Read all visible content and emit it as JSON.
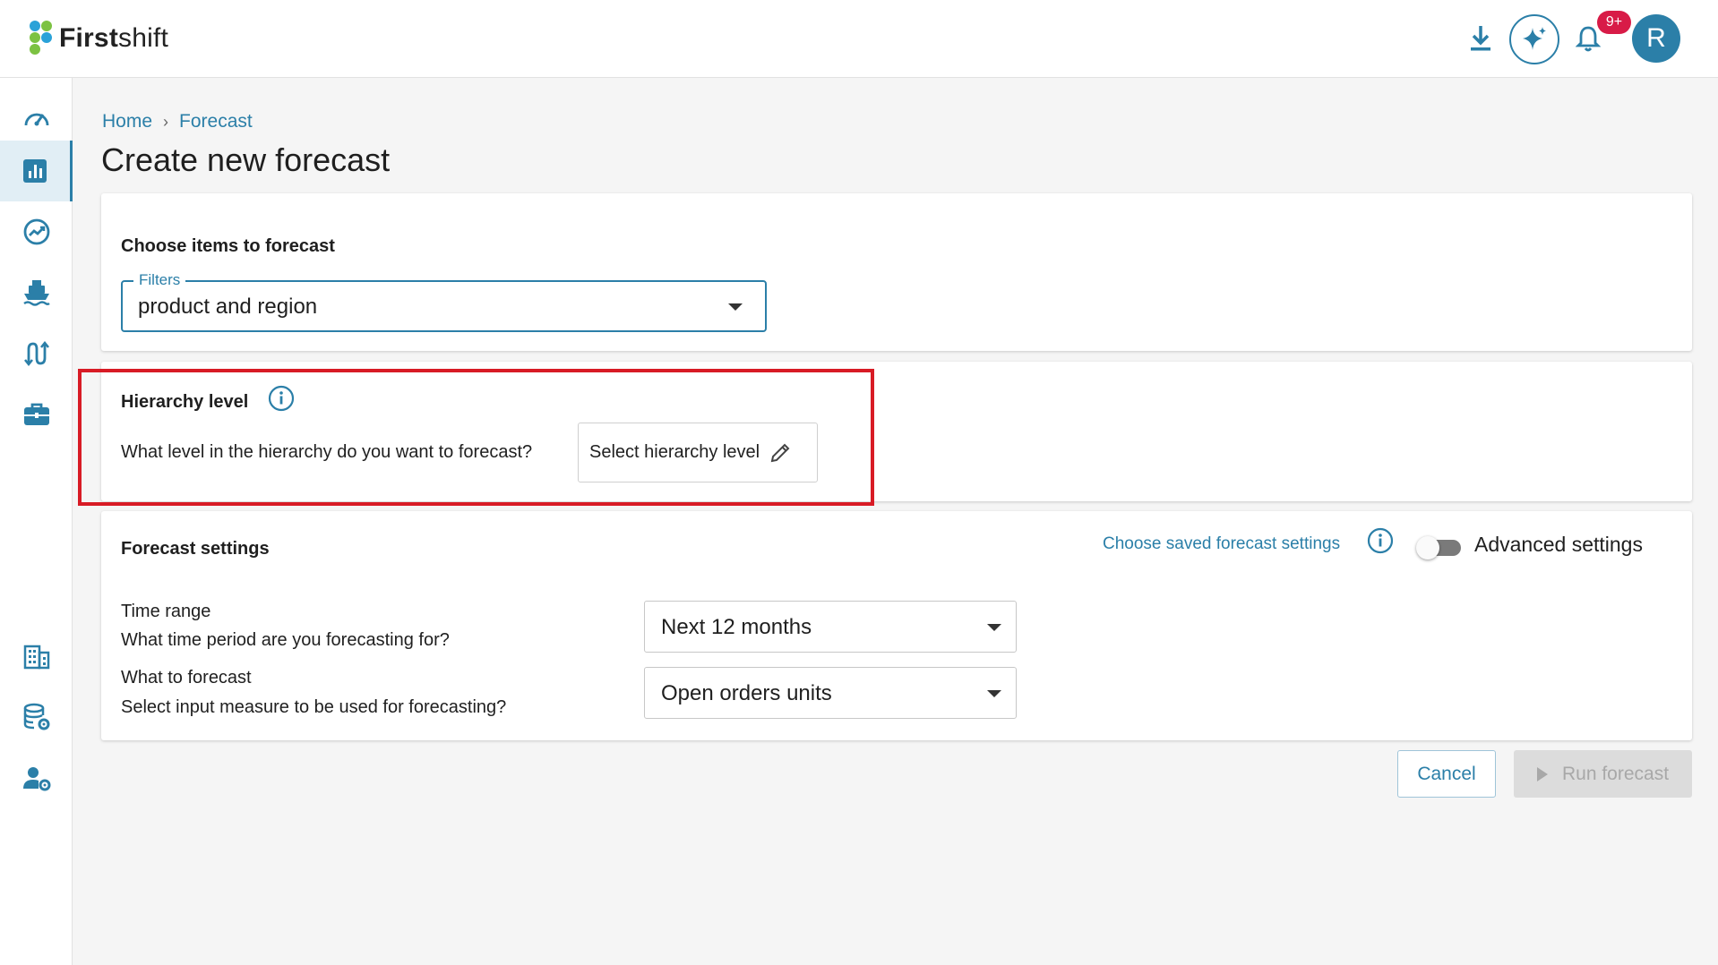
{
  "app": {
    "logo_bold": "First",
    "logo_light": "shift"
  },
  "header": {
    "notification_badge": "9+",
    "avatar_initial": "R"
  },
  "breadcrumb": {
    "home": "Home",
    "separator": "›",
    "current": "Forecast"
  },
  "page": {
    "title": "Create new forecast"
  },
  "items_card": {
    "title": "Choose items to forecast",
    "filters_label": "Filters",
    "filters_value": "product and region"
  },
  "hierarchy_card": {
    "title": "Hierarchy level",
    "question": "What level in the hierarchy do you want to forecast?",
    "button_label": "Select hierarchy level"
  },
  "settings_card": {
    "title": "Forecast settings",
    "saved_link": "Choose saved forecast settings",
    "advanced_label": "Advanced settings",
    "advanced_enabled": false,
    "time_range_label": "Time range",
    "time_range_question": "What time period are you forecasting for?",
    "time_range_value": "Next 12 months",
    "measure_label": "What to forecast",
    "measure_question": "Select input measure to be used for forecasting?",
    "measure_value": "Open orders units"
  },
  "actions": {
    "cancel": "Cancel",
    "run": "Run forecast"
  },
  "colors": {
    "accent": "#2b7fa8",
    "badge": "#d81b47",
    "highlight": "#d81b25"
  },
  "sidebar": {
    "items": [
      {
        "icon": "speedometer-icon",
        "active": false
      },
      {
        "icon": "bar-chart-icon",
        "active": true
      },
      {
        "icon": "trend-icon",
        "active": false
      },
      {
        "icon": "ship-icon",
        "active": false
      },
      {
        "icon": "transfer-icon",
        "active": false
      },
      {
        "icon": "briefcase-icon",
        "active": false
      },
      {
        "icon": "building-icon",
        "active": false
      },
      {
        "icon": "database-settings-icon",
        "active": false
      },
      {
        "icon": "user-settings-icon",
        "active": false
      }
    ]
  }
}
